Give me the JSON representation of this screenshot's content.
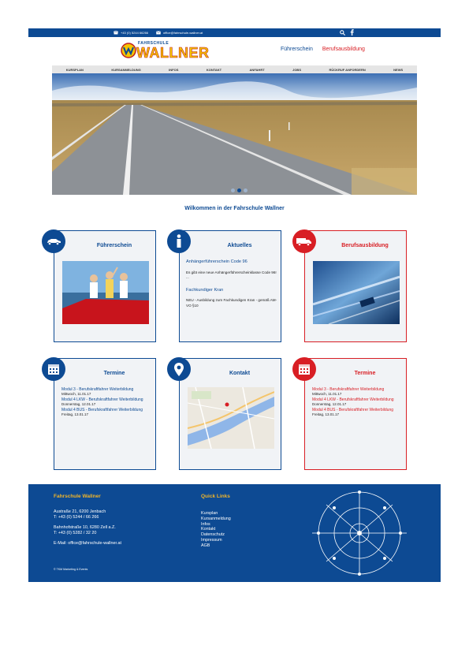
{
  "topbar": {
    "phone": "+43 (0) 5244 66266",
    "email": "office@fahrschule-wallner.at"
  },
  "logo": {
    "small": "FAHRSCHULE",
    "big": "WALLNER"
  },
  "mainnav": [
    {
      "label": "Führerschein",
      "color": "#0d4a93"
    },
    {
      "label": "Berufsausbildung",
      "color": "#d81e24"
    }
  ],
  "menu": [
    "KURSPLAN",
    "KURSANMELDUNG",
    "INFOS",
    "KONTAKT",
    "ANFAHRT",
    "JOBS",
    "RÜCKRUF ANFORDERN",
    "NEWS"
  ],
  "welcome": "Wilkommen in der Fahrschule Wallner",
  "cards": {
    "fuehrerschein": {
      "title": "Führerschein"
    },
    "aktuelles": {
      "title": "Aktuelles",
      "news": [
        {
          "headline": "Anhängerführerschein Code 96",
          "text": "Es gibt eine neue Anhängerführerscheinklasse Code 96! ..."
        },
        {
          "headline": "Fachkundiger Kran",
          "text": "NEU - Ausbildung zum Fachkundigen Kran - gemäß AM-VO §10"
        }
      ]
    },
    "berufsausbildung": {
      "title": "Berufsausbildung"
    },
    "termine1": {
      "title": "Termine",
      "events": [
        {
          "name": "Modul 3 - Berufskraftfahrer Weiterbildung",
          "date": "Mittwoch, 11.01.17"
        },
        {
          "name": "Modul 4 LKW - Berufskraftfahrer Weiterbildung",
          "date": "Donnerstag, 12.01.17"
        },
        {
          "name": "Modul 4 BUS - Berufskraftfahrer Weiterbildung",
          "date": "Freitag, 13.01.17"
        }
      ]
    },
    "kontakt": {
      "title": "Kontakt"
    },
    "termine2": {
      "title": "Termine",
      "events": [
        {
          "name": "Modul 3 - Berufskraftfahrer Weiterbildung",
          "date": "Mittwoch, 11.01.17"
        },
        {
          "name": "Modul 4 LKW - Berufskraftfahrer Weiterbildung",
          "date": "Donnerstag, 12.01.17"
        },
        {
          "name": "Modul 4 BUS - Berufskraftfahrer Weiterbildung",
          "date": "Freitag, 13.01.17"
        }
      ]
    }
  },
  "footer": {
    "title": "Fahrschule Wallner",
    "address1": "Austraße 21, 6200 Jenbach",
    "phone1": "T: +43 (0) 5244 / 66 266",
    "address2": "Bahnhofstraße 10, 6280 Zell a.Z.",
    "phone2": "T: +43 (0) 5282 / 32 20",
    "email": "E-Mail: office@fahrschule-wallner.at",
    "links_title": "Quick Links",
    "links": [
      "Kursplan",
      "Kursanmeldung",
      "Infos",
      "Kontakt",
      "Datenschutz",
      "Impressum",
      "AGB"
    ],
    "copyright": "© TKM Marketing & Events"
  },
  "colors": {
    "brand_blue": "#0d4a93",
    "brand_red": "#d81e24",
    "footer_heading": "#f0b429"
  },
  "icons": {
    "topbar": [
      "phone-icon",
      "mail-icon",
      "search-icon",
      "facebook-icon"
    ],
    "cards": [
      "car-icon",
      "info-icon",
      "truck-icon",
      "calendar-icon",
      "location-pin-icon",
      "calendar-icon"
    ]
  }
}
